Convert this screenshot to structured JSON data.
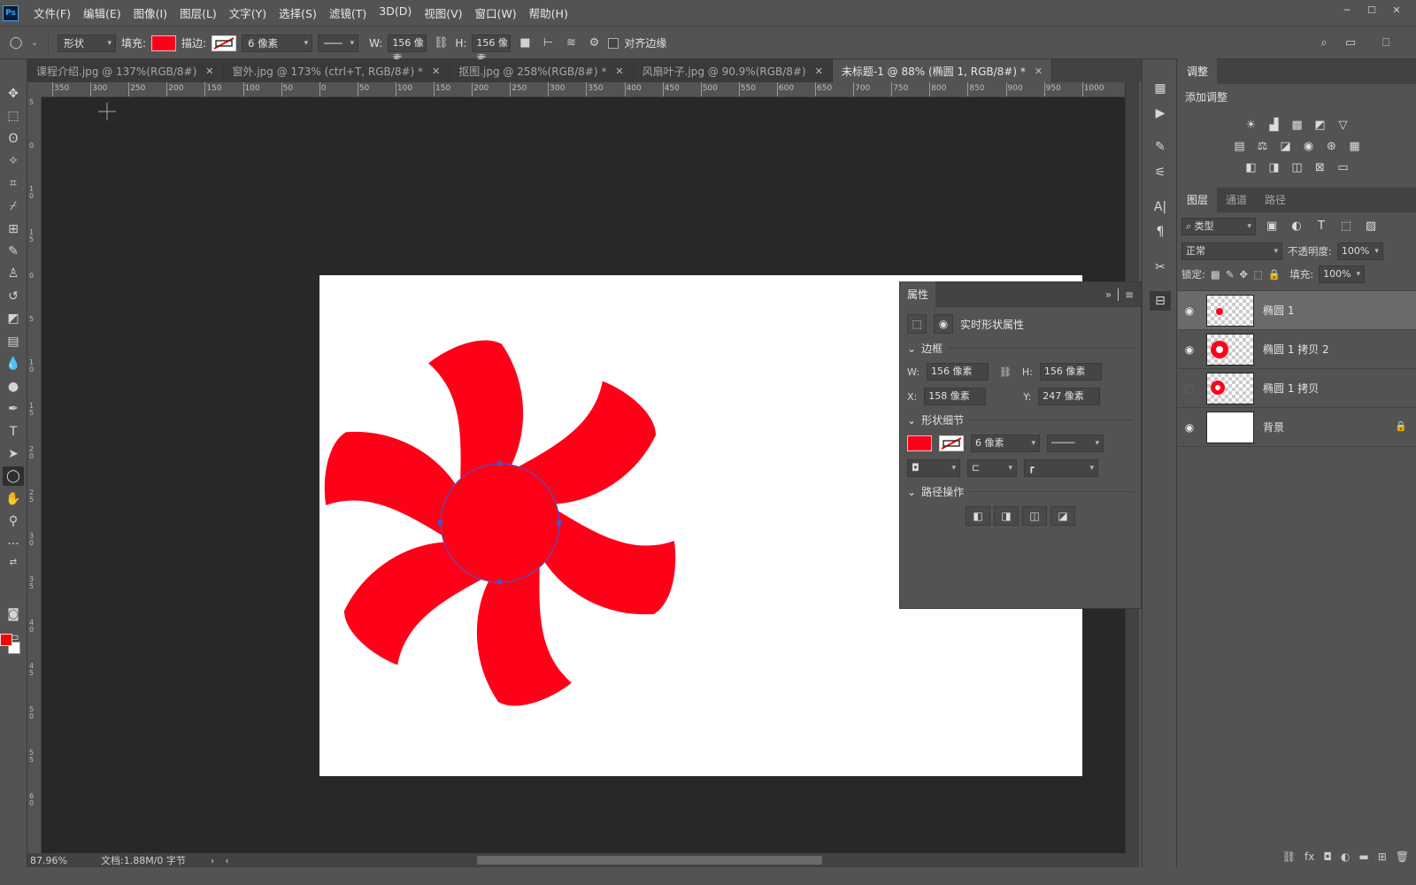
{
  "menubar": {
    "logo": "Ps",
    "items": [
      "文件(F)",
      "编辑(E)",
      "图像(I)",
      "图层(L)",
      "文字(Y)",
      "选择(S)",
      "滤镜(T)",
      "3D(D)",
      "视图(V)",
      "窗口(W)",
      "帮助(H)"
    ]
  },
  "options": {
    "mode": "形状",
    "fill_label": "填充:",
    "fill_color": "#ff0019",
    "stroke_label": "描边:",
    "stroke_width": "6 像素",
    "w_label": "W:",
    "w_value": "156 像素",
    "h_label": "H:",
    "h_value": "156 像素",
    "align_edges": "对齐边缘"
  },
  "tabs": [
    {
      "label": "课程介绍.jpg @ 137%(RGB/8#)"
    },
    {
      "label": "窗外.jpg @ 173% (ctrl+T, RGB/8#) *"
    },
    {
      "label": "抠图.jpg @ 258%(RGB/8#) *"
    },
    {
      "label": "风扇叶子.jpg @ 90.9%(RGB/8#)"
    },
    {
      "label": "未标题-1 @ 88% (椭圆 1, RGB/8#) *"
    }
  ],
  "ruler_h": [
    "350",
    "300",
    "250",
    "200",
    "150",
    "100",
    "50",
    "0",
    "50",
    "100",
    "150",
    "200",
    "250",
    "300",
    "350",
    "400",
    "450",
    "500",
    "550",
    "600",
    "650",
    "700",
    "750",
    "800",
    "850",
    "900",
    "950",
    "1000"
  ],
  "ruler_v": [
    "5",
    "0",
    "1 0",
    "1 5",
    "0",
    "5",
    "1 0",
    "1 5",
    "2 0",
    "2 5",
    "3 0",
    "3 5",
    "4 0",
    "4 5",
    "5 0",
    "5 5",
    "6 0"
  ],
  "status": {
    "zoom": "87.96%",
    "doc": "文档:1.88M/0 字节"
  },
  "properties": {
    "title": "属性",
    "subtitle": "实时形状属性",
    "bounds_title": "边框",
    "w_label": "W:",
    "w": "156 像素",
    "h_label": "H:",
    "h": "156 像素",
    "x_label": "X:",
    "x": "158 像素",
    "y_label": "Y:",
    "y": "247 像素",
    "shape_title": "形状细节",
    "stroke_width": "6 像素",
    "path_title": "路径操作",
    "fill_color": "#ff0019"
  },
  "adjust": {
    "tab": "调整",
    "add_label": "添加调整"
  },
  "layers_panel": {
    "tabs": [
      "图层",
      "通道",
      "路径"
    ],
    "filter": "类型",
    "blend": "正常",
    "opacity_label": "不透明度:",
    "opacity": "100%",
    "lock_label": "锁定:",
    "fill_label": "填充:",
    "fill": "100%",
    "layers": [
      {
        "name": "椭圆 1"
      },
      {
        "name": "椭圆 1 拷贝 2"
      },
      {
        "name": "椭圆 1 拷贝"
      },
      {
        "name": "背景"
      }
    ]
  },
  "colors": {
    "shape_red": "#ff0019",
    "ui_bg": "#535353",
    "canvas_bg": "#282828"
  }
}
